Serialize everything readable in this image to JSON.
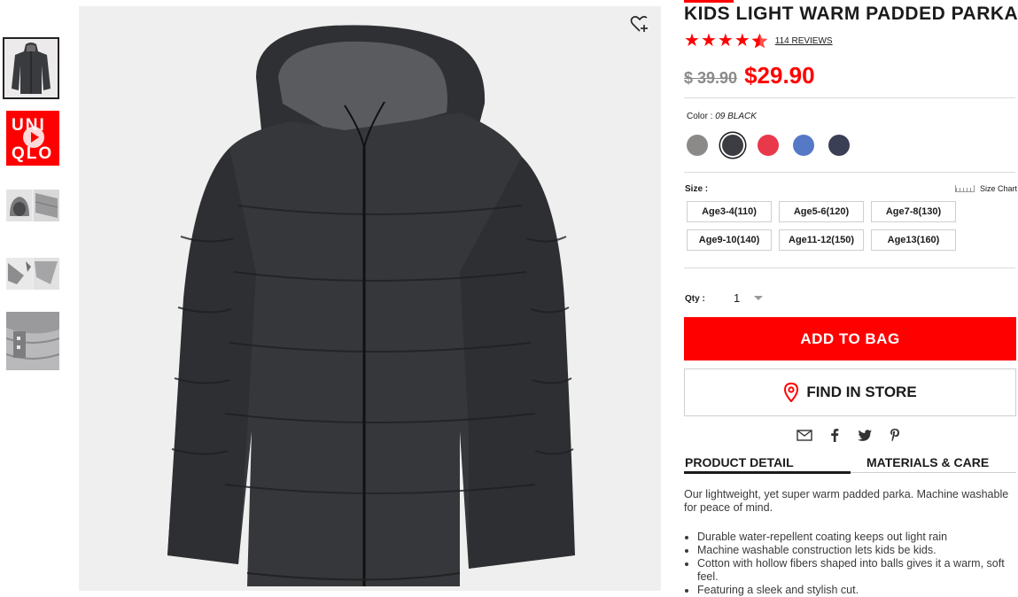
{
  "thumbnails": {
    "video_logo_text": [
      "UNI",
      "QLO"
    ]
  },
  "product": {
    "title": "KIDS LIGHT WARM PADDED PARKA",
    "rating": 4.5,
    "reviews_label": "114 REVIEWS",
    "old_price": "$ 39.90",
    "new_price": "$29.90",
    "color_label": "Color :",
    "color_value": "09 BLACK",
    "swatches": [
      "#8c8a89",
      "#3b3d42",
      "#e8394a",
      "#5579c7",
      "#3a3f55"
    ],
    "size_label": "Size :",
    "size_chart_label": "Size Chart",
    "sizes": [
      "Age3-4(110)",
      "Age5-6(120)",
      "Age7-8(130)",
      "Age9-10(140)",
      "Age11-12(150)",
      "Age13(160)"
    ],
    "qty_label": "Qty :",
    "qty_value": "1",
    "add_to_bag": "ADD TO BAG",
    "find_in_store": "FIND IN STORE",
    "tabs": [
      "PRODUCT DETAIL",
      "MATERIALS & CARE"
    ],
    "description": "Our lightweight, yet super warm padded parka. Machine washable for peace of mind.",
    "bullets": [
      "Durable water-repellent coating keeps out light rain",
      "Machine washable construction lets kids be kids.",
      "Cotton with hollow fibers shaped into balls gives it a warm, soft feel.",
      "Featuring a sleek and stylish cut."
    ]
  },
  "colors": {
    "accent": "#ff0000",
    "text": "#1b1b1b"
  }
}
